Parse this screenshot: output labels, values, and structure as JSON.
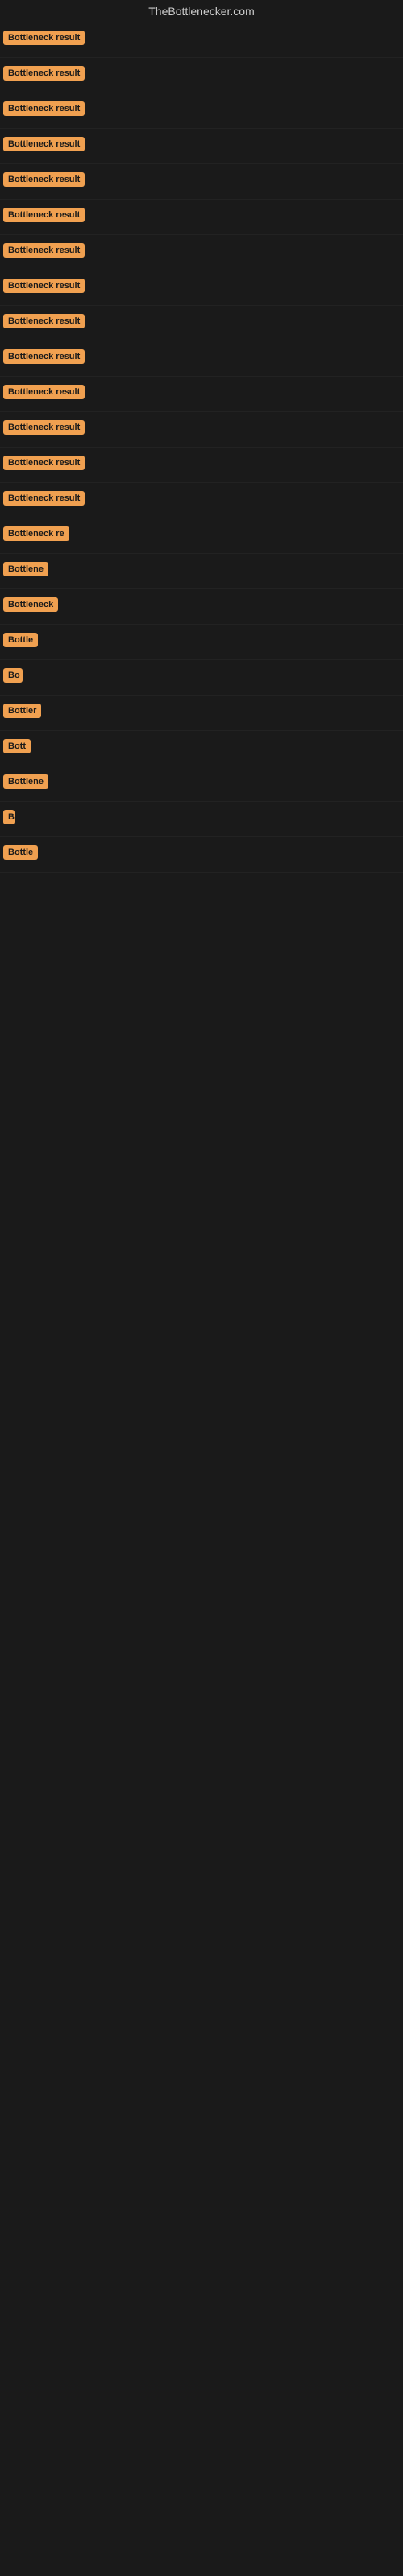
{
  "site": {
    "title": "TheBottlenecker.com"
  },
  "badges": [
    {
      "id": 1,
      "label": "Bottleneck result",
      "width": "full"
    },
    {
      "id": 2,
      "label": "Bottleneck result",
      "width": "full"
    },
    {
      "id": 3,
      "label": "Bottleneck result",
      "width": "full"
    },
    {
      "id": 4,
      "label": "Bottleneck result",
      "width": "full"
    },
    {
      "id": 5,
      "label": "Bottleneck result",
      "width": "full"
    },
    {
      "id": 6,
      "label": "Bottleneck result",
      "width": "full"
    },
    {
      "id": 7,
      "label": "Bottleneck result",
      "width": "full"
    },
    {
      "id": 8,
      "label": "Bottleneck result",
      "width": "full"
    },
    {
      "id": 9,
      "label": "Bottleneck result",
      "width": "full"
    },
    {
      "id": 10,
      "label": "Bottleneck result",
      "width": "full"
    },
    {
      "id": 11,
      "label": "Bottleneck result",
      "width": "full"
    },
    {
      "id": 12,
      "label": "Bottleneck result",
      "width": "full"
    },
    {
      "id": 13,
      "label": "Bottleneck result",
      "width": "full"
    },
    {
      "id": 14,
      "label": "Bottleneck result",
      "width": "full"
    },
    {
      "id": 15,
      "label": "Bottleneck re",
      "width": "partial-15"
    },
    {
      "id": 16,
      "label": "Bottlene",
      "width": "partial-16"
    },
    {
      "id": 17,
      "label": "Bottleneck",
      "width": "partial-17"
    },
    {
      "id": 18,
      "label": "Bottle",
      "width": "partial-18"
    },
    {
      "id": 19,
      "label": "Bo",
      "width": "partial-19"
    },
    {
      "id": 20,
      "label": "Bottler",
      "width": "partial-20"
    },
    {
      "id": 21,
      "label": "Bott",
      "width": "partial-21"
    },
    {
      "id": 22,
      "label": "Bottlene",
      "width": "partial-22"
    },
    {
      "id": 23,
      "label": "B",
      "width": "partial-23"
    },
    {
      "id": 24,
      "label": "Bottle",
      "width": "partial-24"
    }
  ],
  "colors": {
    "badge_bg": "#f0a050",
    "badge_text": "#1a1a1a",
    "background": "#1a1a1a",
    "title_text": "#cccccc"
  }
}
